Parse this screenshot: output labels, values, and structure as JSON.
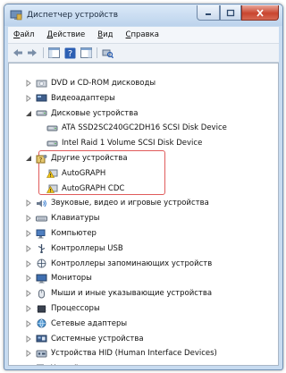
{
  "window": {
    "title": "Диспетчер устройств"
  },
  "menu": [
    "Файл",
    "Действие",
    "Вид",
    "Справка"
  ],
  "tree": [
    {
      "label": "DVD и CD-ROM дисководы",
      "level": 1,
      "expanded": false,
      "icon": "dvd-drive-icon"
    },
    {
      "label": "Видеоадаптеры",
      "level": 1,
      "expanded": false,
      "icon": "display-adapter-icon"
    },
    {
      "label": "Дисковые устройства",
      "level": 1,
      "expanded": true,
      "icon": "disk-drive-icon"
    },
    {
      "label": "ATA SSD2SC240GC2DH16 SCSI Disk Device",
      "level": 2,
      "icon": "disk-drive-icon"
    },
    {
      "label": "Intel Raid 1 Volume SCSI Disk Device",
      "level": 2,
      "icon": "disk-drive-icon"
    },
    {
      "label": "Другие устройства",
      "level": 1,
      "expanded": true,
      "icon": "unknown-device-icon"
    },
    {
      "label": "AutoGRAPH",
      "level": 2,
      "icon": "warning-device-icon"
    },
    {
      "label": "AutoGRAPH CDC",
      "level": 2,
      "icon": "warning-device-icon"
    },
    {
      "label": "Звуковые, видео и игровые устройства",
      "level": 1,
      "expanded": false,
      "icon": "sound-icon"
    },
    {
      "label": "Клавиатуры",
      "level": 1,
      "expanded": false,
      "icon": "keyboard-icon"
    },
    {
      "label": "Компьютер",
      "level": 1,
      "expanded": false,
      "icon": "computer-icon"
    },
    {
      "label": "Контроллеры USB",
      "level": 1,
      "expanded": false,
      "icon": "usb-icon"
    },
    {
      "label": "Контроллеры запоминающих устройств",
      "level": 1,
      "expanded": false,
      "icon": "storage-controller-icon"
    },
    {
      "label": "Мониторы",
      "level": 1,
      "expanded": false,
      "icon": "monitor-icon"
    },
    {
      "label": "Мыши и иные указывающие устройства",
      "level": 1,
      "expanded": false,
      "icon": "mouse-icon"
    },
    {
      "label": "Процессоры",
      "level": 1,
      "expanded": false,
      "icon": "processor-icon"
    },
    {
      "label": "Сетевые адаптеры",
      "level": 1,
      "expanded": false,
      "icon": "network-adapter-icon"
    },
    {
      "label": "Системные устройства",
      "level": 1,
      "expanded": false,
      "icon": "system-device-icon"
    },
    {
      "label": "Устройства HID (Human Interface Devices)",
      "level": 1,
      "expanded": false,
      "icon": "hid-icon"
    },
    {
      "label": "Устройства чтения смарт-карт",
      "level": 1,
      "expanded": false,
      "icon": "smartcard-reader-icon"
    }
  ],
  "highlight_color": "#e05b5b"
}
